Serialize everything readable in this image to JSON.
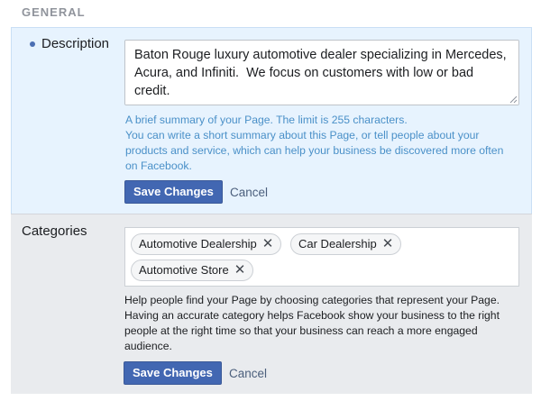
{
  "section": {
    "title": "GENERAL"
  },
  "description": {
    "label": "Description",
    "value": "Baton Rouge luxury automotive dealer specializing in Mercedes, Acura, and Infiniti.  We focus on customers with low or bad credit.",
    "help_lines": [
      "A brief summary of your Page. The limit is 255 characters.",
      "You can write a short summary about this Page, or tell people about your",
      "products and service, which can help your business be discovered more often",
      "on Facebook."
    ],
    "save_label": "Save Changes",
    "cancel_label": "Cancel"
  },
  "categories": {
    "label": "Categories",
    "items": [
      "Automotive Dealership",
      "Car Dealership",
      "Automotive Store"
    ],
    "remove_glyph": "✕",
    "help_lines": [
      "Help people find your Page by choosing categories that represent your Page.",
      "Having an accurate category helps Facebook show your business to the right",
      "people at the right time so that your business can reach a more engaged",
      "audience."
    ],
    "save_label": "Save Changes",
    "cancel_label": "Cancel"
  },
  "colors": {
    "primary_button": "#4267b2",
    "description_panel_bg": "#e7f3fe",
    "categories_panel_bg": "#e9ebee",
    "help_text_blue": "#4a90c8"
  }
}
